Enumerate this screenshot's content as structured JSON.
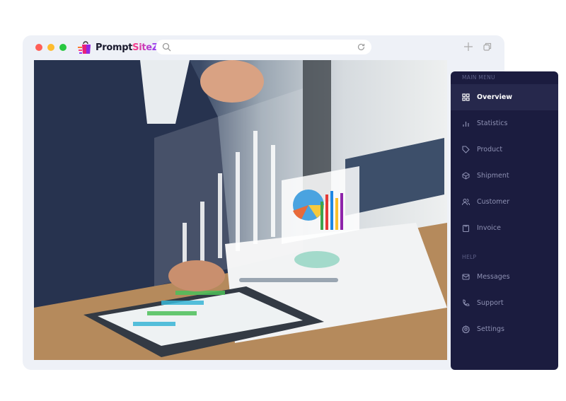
{
  "browser": {
    "traffic_lights": [
      "#ff5f57",
      "#febc2e",
      "#28c840"
    ],
    "logo": "PromptSiteZ",
    "logo_parts": [
      "Prompt",
      "SiteZ"
    ],
    "search_placeholder": "",
    "icons": [
      "search-icon",
      "reload-icon",
      "plus-icon",
      "copy-icon"
    ]
  },
  "sidebar": {
    "main_menu_label": "MAIN MENU",
    "main_items": [
      {
        "label": "Overview",
        "icon": "grid-icon",
        "active": true
      },
      {
        "label": "Statistics",
        "icon": "bar-chart-icon"
      },
      {
        "label": "Product",
        "icon": "tag-icon"
      },
      {
        "label": "Shipment",
        "icon": "box-icon"
      },
      {
        "label": "Customer",
        "icon": "users-icon"
      },
      {
        "label": "Invoice",
        "icon": "clipboard-icon"
      }
    ],
    "help_label": "HELP",
    "help_items": [
      {
        "label": "Messages",
        "icon": "mail-icon"
      },
      {
        "label": "Support",
        "icon": "phone-icon"
      },
      {
        "label": "Settings",
        "icon": "gear-icon"
      }
    ],
    "colors": {
      "background": "#1b1c3f",
      "active": "#26284c"
    }
  }
}
